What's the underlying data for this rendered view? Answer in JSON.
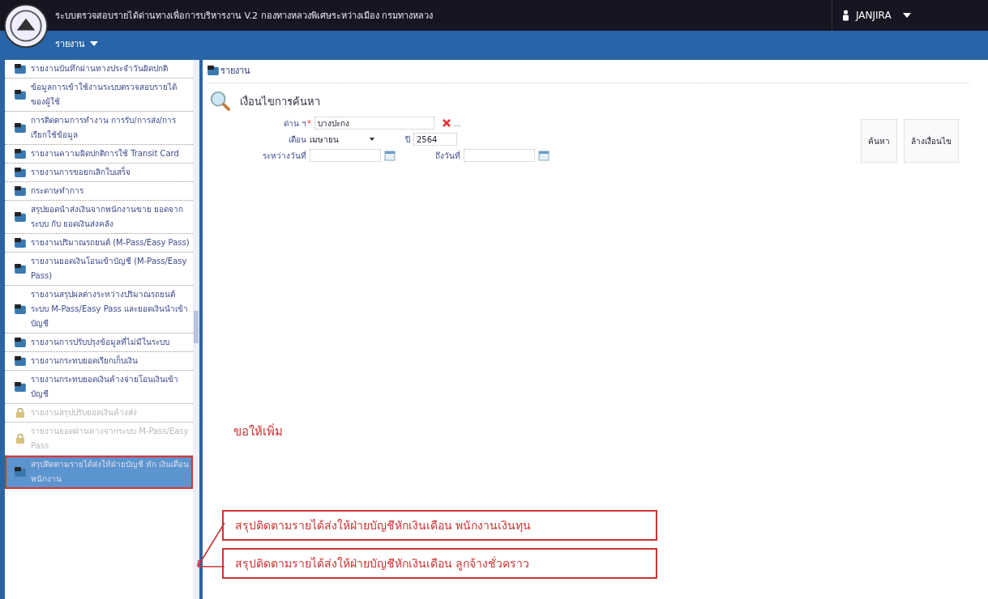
{
  "header": {
    "title": "ระบบตรวจสอบรายได้ด่านทางเพื่อการบริหารงาน V.2 กองทางหลวงพิเศษระหว่างเมือง กรมทางหลวง",
    "user": "JANJIRA"
  },
  "menu_bar": {
    "items": [
      {
        "label": "รายงาน"
      }
    ]
  },
  "sidebar": {
    "items": [
      {
        "label": "รายงานบันทึกผ่านทางประจำวันผิดปกติ",
        "disabled": false,
        "selected": false
      },
      {
        "label": "ข้อมูลการเข้าใช้งานระบบตรวจสอบรายได้ของผู้ใช้",
        "disabled": false,
        "selected": false
      },
      {
        "label": "การติดตามการทำงาน การรับ/การส่ง/การเรียกใช้ข้อมูล",
        "disabled": false,
        "selected": false
      },
      {
        "label": "รายงานความผิดปกติการใช้ Transit Card",
        "disabled": false,
        "selected": false
      },
      {
        "label": "รายงานการขอยกเลิกใบเสร็จ",
        "disabled": false,
        "selected": false
      },
      {
        "label": "กระดาษทำการ",
        "disabled": false,
        "selected": false
      },
      {
        "label": "สรุปยอดนำส่งเงินจากพนักงานขาย ยอดจากระบบ กับ ยอดเงินส่งคลัง",
        "disabled": false,
        "selected": false
      },
      {
        "label": "รายงานปริมาณรถยนต์ (M-Pass/Easy Pass)",
        "disabled": false,
        "selected": false
      },
      {
        "label": "รายงานยอดเงินโอนเข้าบัญชี (M-Pass/Easy Pass)",
        "disabled": false,
        "selected": false
      },
      {
        "label": "รายงานสรุปผลต่างระหว่างปริมาณรถยนต์ ระบบ M-Pass/Easy Pass และยอดเงินนำเข้าบัญชี",
        "disabled": false,
        "selected": false
      },
      {
        "label": "รายงานการปรับปรุงข้อมูลที่ไม่มีในระบบ",
        "disabled": false,
        "selected": false
      },
      {
        "label": "รายงานกระทบยอดเรียกเก็บเงิน",
        "disabled": false,
        "selected": false
      },
      {
        "label": "รายงานกระทบยอดเงินค้างจ่ายโอนเงินเข้าบัญชี",
        "disabled": false,
        "selected": false
      },
      {
        "label": "รายงานสรุปปรับยอดเงินค้างส่ง",
        "disabled": true,
        "selected": false
      },
      {
        "label": "รายงานยอดผ่านทางจากระบบ M-Pass/Easy Pass",
        "disabled": true,
        "selected": false
      },
      {
        "label": "สรุปติดตามรายได้ส่งให้ฝ่ายบัญชี หัก เงินเดือนพนักงาน",
        "disabled": false,
        "selected": true
      }
    ]
  },
  "breadcrumb": "รายงาน",
  "search_panel": {
    "title": "เงื่อนไขการค้นหา",
    "checkpoint": {
      "label": "ด่าน ฯ",
      "required_mark": "*",
      "value": "บางปะกง",
      "more": "..."
    },
    "month": {
      "label": "เดือน",
      "value": "เมษายน"
    },
    "year": {
      "label": "ปี",
      "value": "2564"
    },
    "date_from": {
      "label": "ระหว่างวันที่"
    },
    "date_to": {
      "label": "ถึงวันที่"
    },
    "buttons": [
      "ค้นหา",
      "ล้างเงื่อนไข"
    ]
  },
  "annotations": {
    "note": "ขอให้เพิ่ม",
    "callouts": [
      "สรุปติดตามรายได้ส่งให้ฝ่ายบัญชีหักเงินเดือน พนักงานเงินทุน",
      "สรุปติดตามรายได้ส่งให้ฝ่ายบัญชีหักเงินเดือน ลูกจ้างชั่วคราว"
    ]
  }
}
